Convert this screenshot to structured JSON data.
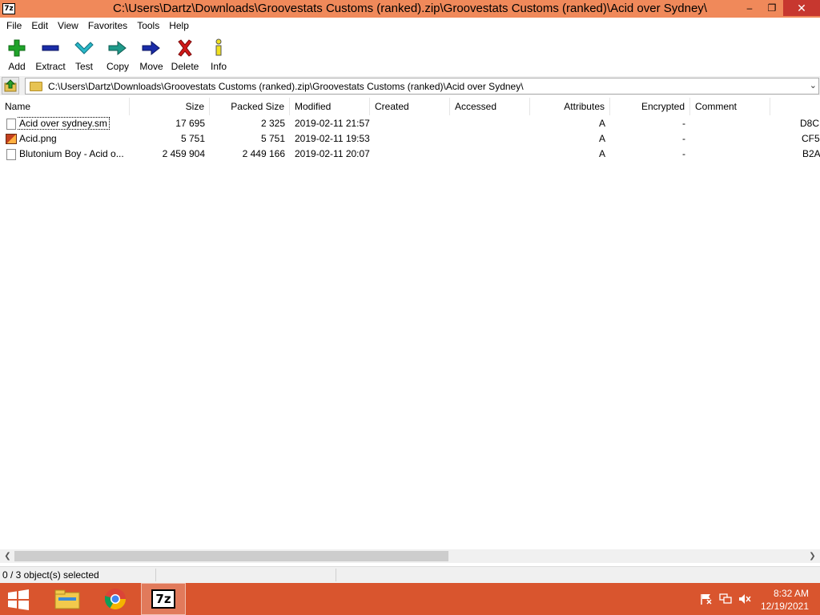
{
  "window": {
    "title": "C:\\Users\\Dartz\\Downloads\\Groovestats Customs (ranked).zip\\Groovestats Customs (ranked)\\Acid over Sydney\\",
    "app_icon_text": "7z",
    "controls": {
      "minimize": "–",
      "restore": "❐",
      "close": "✕"
    }
  },
  "menu": [
    "File",
    "Edit",
    "View",
    "Favorites",
    "Tools",
    "Help"
  ],
  "toolbar": [
    {
      "label": "Add",
      "icon": "add-icon",
      "color": "#1fa32a"
    },
    {
      "label": "Extract",
      "icon": "extract-icon",
      "color": "#1a2ca8"
    },
    {
      "label": "Test",
      "icon": "test-icon",
      "color": "#2ab8c8"
    },
    {
      "label": "Copy",
      "icon": "copy-icon",
      "color": "#1f9a8a"
    },
    {
      "label": "Move",
      "icon": "move-icon",
      "color": "#1a2ca8"
    },
    {
      "label": "Delete",
      "icon": "delete-icon",
      "color": "#d01818"
    },
    {
      "label": "Info",
      "icon": "info-icon",
      "color": "#f0e020"
    }
  ],
  "address": {
    "path": "C:\\Users\\Dartz\\Downloads\\Groovestats Customs (ranked).zip\\Groovestats Customs (ranked)\\Acid over Sydney\\"
  },
  "columns": {
    "name": "Name",
    "size": "Size",
    "packed": "Packed Size",
    "modified": "Modified",
    "created": "Created",
    "accessed": "Accessed",
    "attributes": "Attributes",
    "encrypted": "Encrypted",
    "comment": "Comment"
  },
  "files": [
    {
      "name": "Acid over sydney.sm",
      "size": "17 695",
      "packed": "2 325",
      "modified": "2019-02-11 21:57",
      "attributes": "A",
      "encrypted": "-",
      "crc": "D8C",
      "icon": "document-icon"
    },
    {
      "name": "Acid.png",
      "size": "5 751",
      "packed": "5 751",
      "modified": "2019-02-11 19:53",
      "attributes": "A",
      "encrypted": "-",
      "crc": "CF5",
      "icon": "image-icon"
    },
    {
      "name": "Blutonium Boy - Acid o...",
      "size": "2 459 904",
      "packed": "2 449 166",
      "modified": "2019-02-11 20:07",
      "attributes": "A",
      "encrypted": "-",
      "crc": "B2A",
      "icon": "document-icon"
    }
  ],
  "status": {
    "text": "0 / 3 object(s) selected"
  },
  "taskbar": {
    "apps": [
      "file-explorer-icon",
      "chrome-icon",
      "7zip-icon"
    ],
    "active_app": "7zip-icon",
    "app_icon_text": "7z",
    "clock": {
      "time": "8:32 AM",
      "date": "12/19/2021"
    },
    "colors": {
      "taskbar": "#d9552e",
      "titlebar": "#f0895a"
    }
  }
}
